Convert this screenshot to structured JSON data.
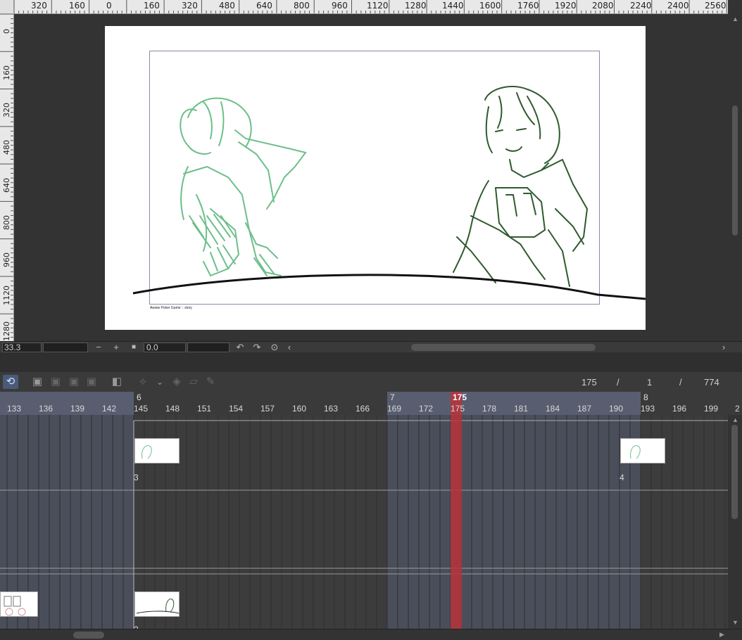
{
  "ruler": {
    "top_labels": [
      "320",
      "160",
      "0",
      "160",
      "320",
      "480",
      "640",
      "800",
      "960",
      "1120",
      "1280",
      "1440",
      "1600",
      "1760",
      "1920",
      "2080",
      "2240",
      "2400",
      "2560"
    ],
    "left_labels": [
      "0",
      "160",
      "320",
      "480",
      "640",
      "800",
      "960",
      "1120",
      "1280"
    ]
  },
  "canvas": {
    "caption": "Awww Poker Game :: story"
  },
  "view_bar": {
    "zoom": "33.3",
    "zoom_out": "−",
    "zoom_in": "+",
    "stop": "■",
    "rotation": "0.0",
    "rotate_left": "↶",
    "rotate_right": "↷",
    "reset": "⊙",
    "scroll_left": "‹",
    "scroll_right": "›"
  },
  "timeline": {
    "current_frame": "175",
    "sep1": "/",
    "count_mid": "1",
    "sep2": "/",
    "total_frames": "774",
    "frame_numbers": [
      "133",
      "136",
      "139",
      "142",
      "145",
      "148",
      "151",
      "154",
      "157",
      "160",
      "163",
      "166",
      "169",
      "172",
      "175",
      "178",
      "181",
      "184",
      "187",
      "190",
      "193",
      "196",
      "199",
      "2"
    ],
    "cut_labels": [
      "6",
      "7",
      "175",
      "8"
    ],
    "cel_labels": [
      "3",
      "4",
      "2"
    ]
  },
  "colors": {
    "playhead": "#b8333a",
    "loop_active": "#4a5a78",
    "cut_shade": "#585e70",
    "sketch_light": "#6cbf8a",
    "sketch_dark": "#2f5a2f"
  }
}
